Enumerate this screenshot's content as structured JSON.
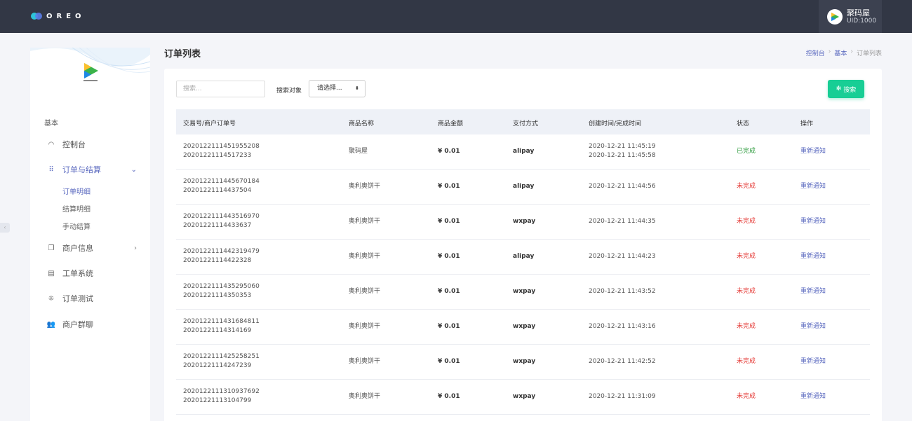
{
  "topbar": {
    "logo_text": "OREO",
    "user_name": "聚码屋",
    "user_uid": "UID:1000"
  },
  "sidebar": {
    "section": "基本",
    "items": [
      {
        "label": "控制台",
        "icon": "gauge-icon"
      },
      {
        "label": "订单与结算",
        "icon": "grid-icon"
      },
      {
        "label": "商户信息",
        "icon": "copy-icon"
      },
      {
        "label": "工单系统",
        "icon": "ticket-icon"
      },
      {
        "label": "订单测试",
        "icon": "test-icon"
      },
      {
        "label": "商户群聊",
        "icon": "group-icon"
      }
    ],
    "subitems": [
      "订单明细",
      "结算明细",
      "手动结算"
    ]
  },
  "header": {
    "title": "订单列表",
    "breadcrumb": [
      "控制台",
      "基本",
      "订单列表"
    ]
  },
  "search": {
    "placeholder": "搜索...",
    "target_label": "搜索对象",
    "select_value": "请选择...",
    "button_label": "搜索"
  },
  "table": {
    "columns": [
      "交易号/商户订单号",
      "商品名称",
      "商品金额",
      "支付方式",
      "创建时间/完成时间",
      "状态",
      "操作"
    ],
    "rows": [
      {
        "trade_no": "2020122111451955208",
        "order_no": "20201221114517233",
        "product": "聚码屋",
        "amount": "¥ 0.01",
        "pay": "alipay",
        "created": "2020-12-21 11:45:19",
        "finished": "2020-12-21 11:45:58",
        "status": "已完成",
        "action": "重新通知"
      },
      {
        "trade_no": "2020122111445670184",
        "order_no": "20201221114437504",
        "product": "奥利奥饼干",
        "amount": "¥ 0.01",
        "pay": "alipay",
        "created": "2020-12-21 11:44:56",
        "finished": "",
        "status": "未完成",
        "action": "重新通知"
      },
      {
        "trade_no": "2020122111443516970",
        "order_no": "20201221114433637",
        "product": "奥利奥饼干",
        "amount": "¥ 0.01",
        "pay": "wxpay",
        "created": "2020-12-21 11:44:35",
        "finished": "",
        "status": "未完成",
        "action": "重新通知"
      },
      {
        "trade_no": "2020122111442319479",
        "order_no": "20201221114422328",
        "product": "奥利奥饼干",
        "amount": "¥ 0.01",
        "pay": "alipay",
        "created": "2020-12-21 11:44:23",
        "finished": "",
        "status": "未完成",
        "action": "重新通知"
      },
      {
        "trade_no": "2020122111435295060",
        "order_no": "20201221114350353",
        "product": "奥利奥饼干",
        "amount": "¥ 0.01",
        "pay": "wxpay",
        "created": "2020-12-21 11:43:52",
        "finished": "",
        "status": "未完成",
        "action": "重新通知"
      },
      {
        "trade_no": "2020122111431684811",
        "order_no": "20201221114314169",
        "product": "奥利奥饼干",
        "amount": "¥ 0.01",
        "pay": "wxpay",
        "created": "2020-12-21 11:43:16",
        "finished": "",
        "status": "未完成",
        "action": "重新通知"
      },
      {
        "trade_no": "2020122111425258251",
        "order_no": "20201221114247239",
        "product": "奥利奥饼干",
        "amount": "¥ 0.01",
        "pay": "wxpay",
        "created": "2020-12-21 11:42:52",
        "finished": "",
        "status": "未完成",
        "action": "重新通知"
      },
      {
        "trade_no": "2020122111310937692",
        "order_no": "20201221113104799",
        "product": "奥利奥饼干",
        "amount": "¥ 0.01",
        "pay": "wxpay",
        "created": "2020-12-21 11:31:09",
        "finished": "",
        "status": "未完成",
        "action": "重新通知"
      }
    ]
  },
  "colors": {
    "topbar": "#323745",
    "accent": "#5c6bc0",
    "search_button": "#18ce95",
    "status_done": "#2e9b3e",
    "status_pending": "#e53935"
  }
}
